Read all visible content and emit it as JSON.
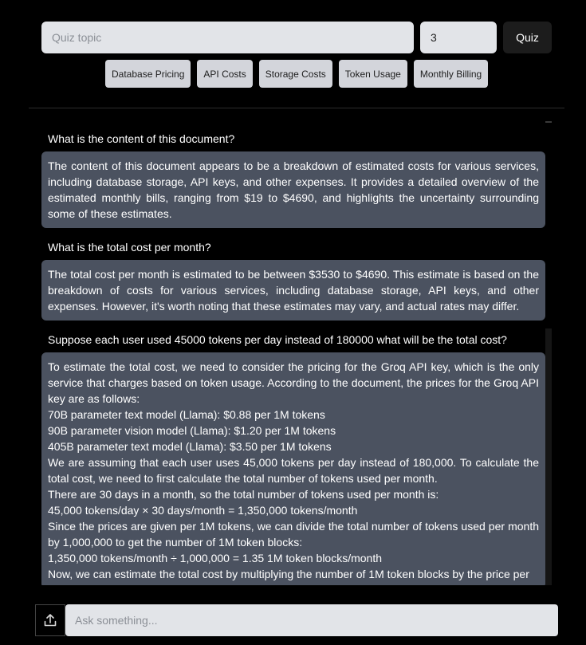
{
  "quiz": {
    "topic_placeholder": "Quiz topic",
    "count_value": "3",
    "button_label": "Quiz"
  },
  "suggestions": [
    "Database Pricing",
    "API Costs",
    "Storage Costs",
    "Token Usage",
    "Monthly Billing"
  ],
  "messages": [
    {
      "question": "What is the content of this document?",
      "answer": "The content of this document appears to be a breakdown of estimated costs for various services, including database storage, API keys, and other expenses. It provides a detailed overview of the estimated monthly bills, ranging from $19 to $4690, and highlights the uncertainty surrounding some of these estimates."
    },
    {
      "question": "What is the total cost per month?",
      "answer": "The total cost per month is estimated to be between $3530 to $4690. This estimate is based on the breakdown of costs for various services, including database storage, API keys, and other expenses. However, it's worth noting that these estimates may vary, and actual rates may differ."
    },
    {
      "question": "Suppose each user used 45000 tokens per day instead of 180000 what will be the total cost?",
      "answer_lines": [
        "To estimate the total cost, we need to consider the pricing for the Groq API key, which is the only service that charges based on token usage. According to the document, the prices for the Groq API key are as follows:",
        "70B parameter text model (Llama): $0.88 per 1M tokens",
        "90B parameter vision model (Llama): $1.20 per 1M tokens",
        "405B parameter text model (Llama): $3.50 per 1M tokens",
        "We are assuming that each user uses 45,000 tokens per day instead of 180,000. To calculate the total cost, we need to first calculate the total number of tokens used per month.",
        "There are 30 days in a month, so the total number of tokens used per month is:",
        "45,000 tokens/day × 30 days/month = 1,350,000 tokens/month",
        "Since the prices are given per 1M tokens, we can divide the total number of tokens used per month by 1,000,000 to get the number of 1M token blocks:",
        "1,350,000 tokens/month ÷ 1,000,000 = 1.35 1M token blocks/month",
        "Now, we can estimate the total cost by multiplying the number of 1M token blocks by the price per"
      ]
    }
  ],
  "composer": {
    "placeholder": "Ask something...",
    "upload_icon": "upload-icon"
  }
}
